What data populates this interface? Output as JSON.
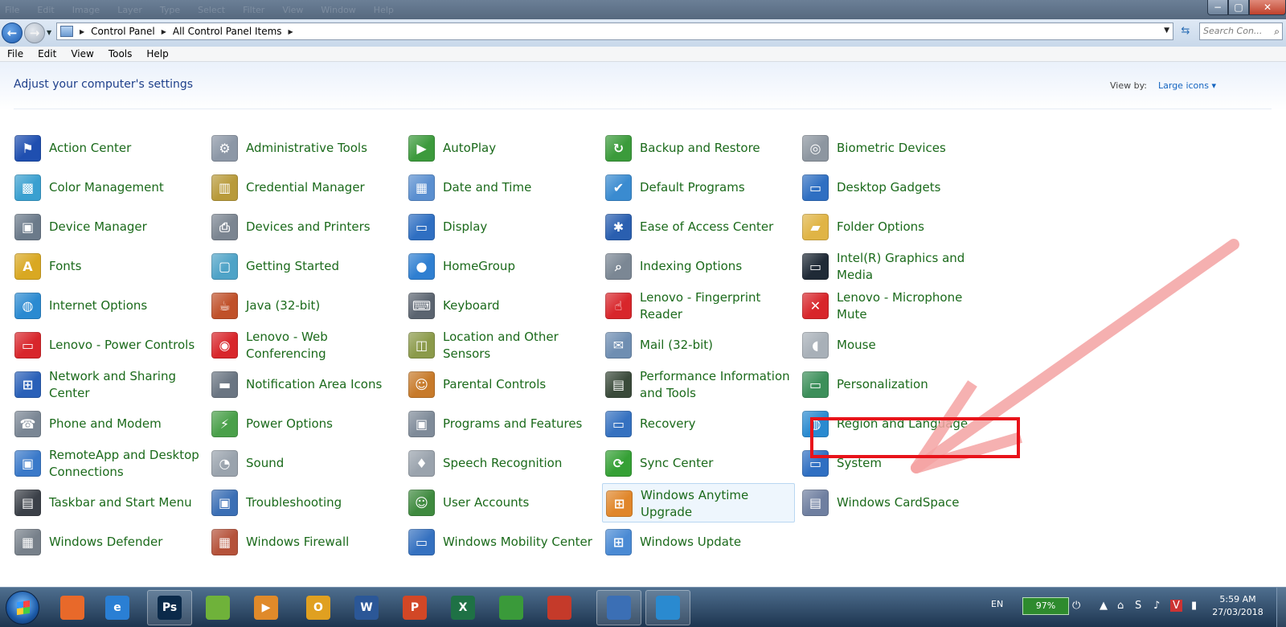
{
  "window": {
    "menu_ghost": [
      "File",
      "Edit",
      "Image",
      "Layer",
      "Type",
      "Select",
      "Filter",
      "View",
      "Window",
      "Help"
    ],
    "minimize": "−",
    "maximize": "▢",
    "close": "✕"
  },
  "address": {
    "crumbs": [
      "Control Panel",
      "All Control Panel Items"
    ],
    "search_placeholder": "Search Con..."
  },
  "menubar": [
    "File",
    "Edit",
    "View",
    "Tools",
    "Help"
  ],
  "header": {
    "title": "Adjust your computer's settings",
    "view_by_label": "View by:",
    "view_by_value": "Large icons"
  },
  "items": [
    [
      {
        "label": "Action Center",
        "icon": "flag-icon",
        "color": "#1f4fb0"
      },
      {
        "label": "Color Management",
        "icon": "color-management-icon",
        "color": "#3aa0d0"
      },
      {
        "label": "Device Manager",
        "icon": "device-manager-icon",
        "color": "#6b7a8a"
      },
      {
        "label": "Fonts",
        "icon": "fonts-folder-icon",
        "color": "#d9a822"
      },
      {
        "label": "Internet Options",
        "icon": "globe-check-icon",
        "color": "#2b8ad1"
      },
      {
        "label": "Lenovo - Power Controls",
        "icon": "battery-icon",
        "color": "#d8262b"
      },
      {
        "label": "Network and Sharing Center",
        "icon": "network-icon",
        "color": "#2a60b8"
      },
      {
        "label": "Phone and Modem",
        "icon": "phone-icon",
        "color": "#7a8694"
      },
      {
        "label": "RemoteApp and Desktop Connections",
        "icon": "remote-desktop-icon",
        "color": "#3a79c9"
      },
      {
        "label": "Taskbar and Start Menu",
        "icon": "taskbar-icon",
        "color": "#3b4048"
      },
      {
        "label": "Windows Defender",
        "icon": "castle-wall-icon",
        "color": "#77808a"
      }
    ],
    [
      {
        "label": "Administrative Tools",
        "icon": "admin-tools-icon",
        "color": "#8c97a6"
      },
      {
        "label": "Credential Manager",
        "icon": "vault-icon",
        "color": "#b89a3a"
      },
      {
        "label": "Devices and Printers",
        "icon": "printer-icon",
        "color": "#7b8591"
      },
      {
        "label": "Getting Started",
        "icon": "getting-started-icon",
        "color": "#4fa3c7"
      },
      {
        "label": "Java (32-bit)",
        "icon": "java-icon",
        "color": "#c0512a"
      },
      {
        "label": "Lenovo - Web Conferencing",
        "icon": "camera-icon",
        "color": "#d8262b"
      },
      {
        "label": "Notification Area Icons",
        "icon": "notification-icon",
        "color": "#6a7582"
      },
      {
        "label": "Power Options",
        "icon": "power-icon",
        "color": "#4aa04a"
      },
      {
        "label": "Sound",
        "icon": "speaker-icon",
        "color": "#9aa3ad"
      },
      {
        "label": "Troubleshooting",
        "icon": "troubleshoot-icon",
        "color": "#3b6fb5"
      },
      {
        "label": "Windows Firewall",
        "icon": "firewall-icon",
        "color": "#b5523a"
      }
    ],
    [
      {
        "label": "AutoPlay",
        "icon": "autoplay-icon",
        "color": "#3c9a3c"
      },
      {
        "label": "Date and Time",
        "icon": "calendar-clock-icon",
        "color": "#5a8fd0"
      },
      {
        "label": "Display",
        "icon": "monitor-icon",
        "color": "#2f6fc2"
      },
      {
        "label": "HomeGroup",
        "icon": "homegroup-icon",
        "color": "#2f7fd1"
      },
      {
        "label": "Keyboard",
        "icon": "keyboard-icon",
        "color": "#5b6470"
      },
      {
        "label": "Location and Other Sensors",
        "icon": "map-sensor-icon",
        "color": "#8b9a4a"
      },
      {
        "label": "Parental Controls",
        "icon": "parental-icon",
        "color": "#c77a2a"
      },
      {
        "label": "Programs and Features",
        "icon": "programs-icon",
        "color": "#7f8b99"
      },
      {
        "label": "Speech Recognition",
        "icon": "microphone-icon",
        "color": "#9aa3ad"
      },
      {
        "label": "User Accounts",
        "icon": "users-icon",
        "color": "#3f8a3f"
      },
      {
        "label": "Windows Mobility Center",
        "icon": "mobility-icon",
        "color": "#3571c0"
      }
    ],
    [
      {
        "label": "Backup and Restore",
        "icon": "backup-icon",
        "color": "#3b9b3b"
      },
      {
        "label": "Default Programs",
        "icon": "default-programs-icon",
        "color": "#3a8bd0"
      },
      {
        "label": "Ease of Access Center",
        "icon": "ease-access-icon",
        "color": "#2a5fb0"
      },
      {
        "label": "Indexing Options",
        "icon": "magnifier-icon",
        "color": "#7b8794"
      },
      {
        "label": "Lenovo - Fingerprint Reader",
        "icon": "fingerprint-icon",
        "color": "#d8262b"
      },
      {
        "label": "Mail (32-bit)",
        "icon": "mail-icon",
        "color": "#6f8eb2"
      },
      {
        "label": "Performance Information and Tools",
        "icon": "performance-icon",
        "color": "#3a4a3a"
      },
      {
        "label": "Recovery",
        "icon": "recovery-icon",
        "color": "#3571c0"
      },
      {
        "label": "Sync Center",
        "icon": "sync-icon",
        "color": "#35a035"
      },
      {
        "label": "Windows Anytime Upgrade",
        "icon": "windows-logo-icon",
        "color": "#e0862a"
      },
      {
        "label": "Windows Update",
        "icon": "windows-update-icon",
        "color": "#4a8ad4"
      }
    ],
    [
      {
        "label": "Biometric Devices",
        "icon": "biometric-icon",
        "color": "#8d96a0"
      },
      {
        "label": "Desktop Gadgets",
        "icon": "gadgets-icon",
        "color": "#2f6fc2"
      },
      {
        "label": "Folder Options",
        "icon": "folder-icon",
        "color": "#e0b445"
      },
      {
        "label": "Intel(R) Graphics and Media",
        "icon": "intel-graphics-icon",
        "color": "#1f2a36"
      },
      {
        "label": "Lenovo - Microphone Mute",
        "icon": "mic-mute-icon",
        "color": "#d8262b"
      },
      {
        "label": "Mouse",
        "icon": "mouse-icon",
        "color": "#a8b0b8"
      },
      {
        "label": "Personalization",
        "icon": "personalization-icon",
        "color": "#3c8f5a"
      },
      {
        "label": "Region and Language",
        "icon": "globe-clock-icon",
        "color": "#2a8ad0"
      },
      {
        "label": "System",
        "icon": "system-icon",
        "color": "#2f6fc2"
      },
      {
        "label": "Windows CardSpace",
        "icon": "cardspace-icon",
        "color": "#6f7fa0"
      }
    ]
  ],
  "highlighted_item": "Windows Anytime Upgrade",
  "annotation": {
    "boxed_item": "Region and Language",
    "box_color": "#e8131a",
    "arrow_color": "#f4a3a3"
  },
  "taskbar": {
    "apps": [
      {
        "name": "firefox-icon",
        "glyph": "",
        "color": "#e8692a"
      },
      {
        "name": "internet-explorer-icon",
        "glyph": "e",
        "color": "#2a7fd4"
      },
      {
        "name": "photoshop-icon",
        "glyph": "Ps",
        "color": "#0b2a4a"
      },
      {
        "name": "uc-browser-icon",
        "glyph": "",
        "color": "#6fb23a"
      },
      {
        "name": "media-player-icon",
        "glyph": "▶",
        "color": "#e08a2a"
      },
      {
        "name": "outlook-icon",
        "glyph": "O",
        "color": "#e0a020"
      },
      {
        "name": "word-icon",
        "glyph": "W",
        "color": "#2b5797"
      },
      {
        "name": "powerpoint-icon",
        "glyph": "P",
        "color": "#d24726"
      },
      {
        "name": "excel-icon",
        "glyph": "X",
        "color": "#1e7145"
      },
      {
        "name": "chrome-icon",
        "glyph": "",
        "color": "#3a9a3a"
      },
      {
        "name": "chrome-red-icon",
        "glyph": "",
        "color": "#c53a2a"
      },
      {
        "name": "control-panel-icon",
        "glyph": "",
        "color": "#3b6fb5"
      },
      {
        "name": "region-language-globe-icon",
        "glyph": "",
        "color": "#2a8ad0"
      }
    ],
    "language": "EN",
    "battery": "97%",
    "time": "5:59 AM",
    "date": "27/03/2018"
  }
}
